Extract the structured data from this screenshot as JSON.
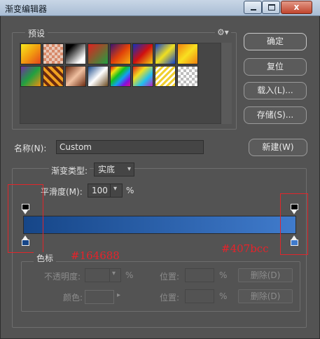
{
  "window": {
    "title": "渐变编辑器",
    "minimize_glyph": "",
    "maximize_glyph": "",
    "close_glyph": "x"
  },
  "presets": {
    "legend": "预设",
    "gear_icon": "⚙▾",
    "swatches": [
      {
        "name": "yellow-orange",
        "bg": "linear-gradient(135deg,#f7e91e,#f29d10,#e5451b)"
      },
      {
        "name": "checker-orange",
        "bg": "repeating-conic-gradient(#d88a6a 0 25%,#e8c8b8 0 50%) 0 0/8px 8px"
      },
      {
        "name": "black-white",
        "bg": "linear-gradient(135deg,#000 20%,#fff 80%)"
      },
      {
        "name": "red-green",
        "bg": "linear-gradient(135deg,#e02020,#20a040)"
      },
      {
        "name": "violet-orange",
        "bg": "linear-gradient(135deg,#3a1470,#e0400a,#f6b010)"
      },
      {
        "name": "blue-red-yellow",
        "bg": "linear-gradient(135deg,#1030c0,#d01010,#f0d010)"
      },
      {
        "name": "blue-yellow-blue",
        "bg": "linear-gradient(135deg,#1040d0,#f0e020,#1040d0)"
      },
      {
        "name": "orange-yellow-orange",
        "bg": "linear-gradient(135deg,#f08010,#f8e020,#f08010)"
      },
      {
        "name": "violet-green-orange",
        "bg": "linear-gradient(135deg,#7030a0,#20a040,#f09010)"
      },
      {
        "name": "stripes-warm",
        "bg": "repeating-linear-gradient(45deg,#f0a020 0 4px,#6a2a10 4px 8px)"
      },
      {
        "name": "copper",
        "bg": "linear-gradient(135deg,#6a2a10,#f0c0a0,#6a2a10)"
      },
      {
        "name": "chrome",
        "bg": "linear-gradient(135deg,#1a4a8a,#ffffff,#6a4a20)"
      },
      {
        "name": "spectrum",
        "bg": "linear-gradient(135deg,#e01010,#f0e010,#10c020,#10a0f0,#8010e0,#e01080)"
      },
      {
        "name": "transparent-rainbow",
        "bg": "linear-gradient(135deg,#e02020,#f0e020,#20c0f0,#c020c0)"
      },
      {
        "name": "transparent-stripes",
        "bg": "repeating-linear-gradient(135deg,#f0d030 0 3px,#ffffff 3px 6px)"
      },
      {
        "name": "transparent",
        "bg": "repeating-conic-gradient(#bdbdbd 0 25%,#ffffff 0 50%) 0 0/8px 8px"
      }
    ]
  },
  "buttons": {
    "ok": "确定",
    "reset": "复位",
    "load": "载入(L)...",
    "save": "存储(S)...",
    "new": "新建(W)"
  },
  "name_field": {
    "label": "名称(N):",
    "value": "Custom"
  },
  "gradient_type": {
    "label": "渐变类型:",
    "value": "实底"
  },
  "smoothness": {
    "label": "平滑度(M):",
    "value": "100",
    "unit": "%"
  },
  "gradient": {
    "start_color": "#164688",
    "end_color": "#407bcc"
  },
  "annotations": {
    "left": "#164688",
    "right": "#407bcc"
  },
  "stops": {
    "legend": "色标",
    "opacity_label": "不透明度:",
    "opacity_unit": "%",
    "location_label": "位置:",
    "location_unit": "%",
    "delete_label": "删除(D)",
    "color_label": "颜色:"
  }
}
